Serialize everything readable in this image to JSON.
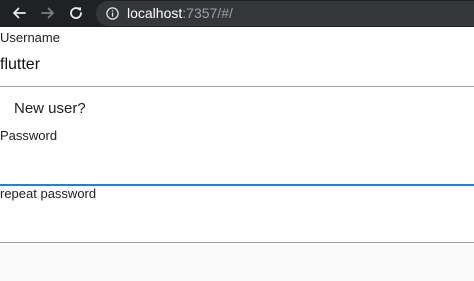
{
  "browser": {
    "url_host": "localhost",
    "url_rest": ":7357/#/",
    "icons": {
      "back": "back-arrow-icon",
      "forward": "forward-arrow-icon",
      "reload": "reload-icon",
      "info": "info-icon"
    }
  },
  "form": {
    "username_label": "Username",
    "username_value": "flutter",
    "new_user_button": "New user?",
    "password_label": "Password",
    "password_value": "",
    "repeat_password_label": "repeat password",
    "repeat_password_value": ""
  },
  "colors": {
    "focus_accent": "#2c7bd6",
    "toolbar_bg": "#202124"
  }
}
